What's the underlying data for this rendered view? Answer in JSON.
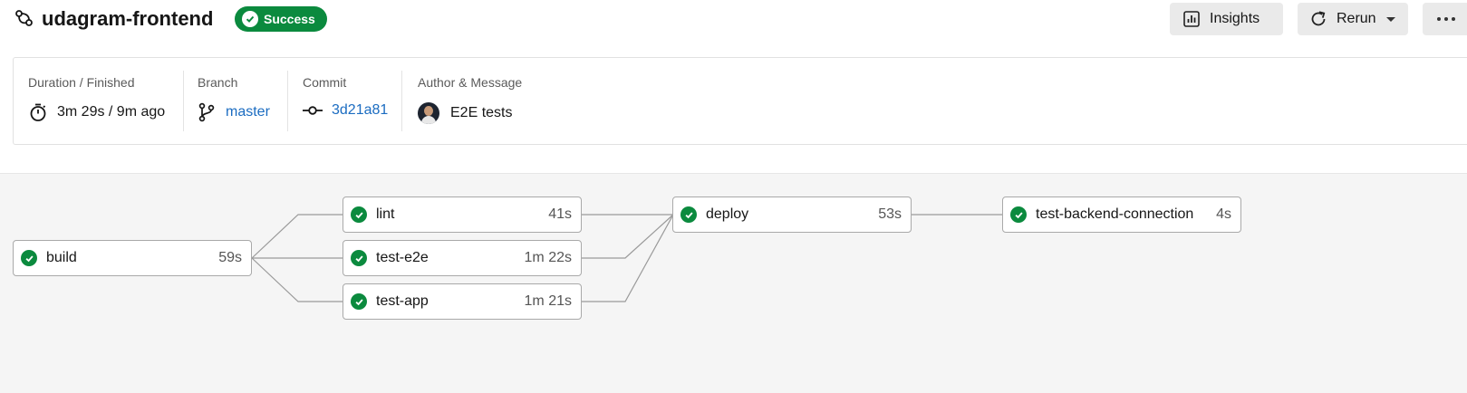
{
  "workflow": {
    "name": "udagram-frontend",
    "status": "Success",
    "status_color": "#0b8a3e",
    "icon": "workflow-icon"
  },
  "actions": {
    "insights_label": "Insights",
    "rerun_label": "Rerun",
    "more_icon": "more-horizontal-icon"
  },
  "info": {
    "duration_label": "Duration / Finished",
    "duration_value": "3m 29s / 9m ago",
    "branch_label": "Branch",
    "branch_value": "master",
    "commit_label": "Commit",
    "commit_value": "3d21a81",
    "author_label": "Author & Message",
    "author_message": "E2E tests",
    "link_color": "#1b6cc1"
  },
  "jobs": [
    {
      "id": "build",
      "name": "build",
      "duration": "59s",
      "status": "success"
    },
    {
      "id": "lint",
      "name": "lint",
      "duration": "41s",
      "status": "success"
    },
    {
      "id": "test-e2e",
      "name": "test-e2e",
      "duration": "1m 22s",
      "status": "success"
    },
    {
      "id": "test-app",
      "name": "test-app",
      "duration": "1m 21s",
      "status": "success"
    },
    {
      "id": "deploy",
      "name": "deploy",
      "duration": "53s",
      "status": "success"
    },
    {
      "id": "test-backend-connection",
      "name": "test-backend-connection",
      "duration": "4s",
      "status": "success"
    }
  ]
}
